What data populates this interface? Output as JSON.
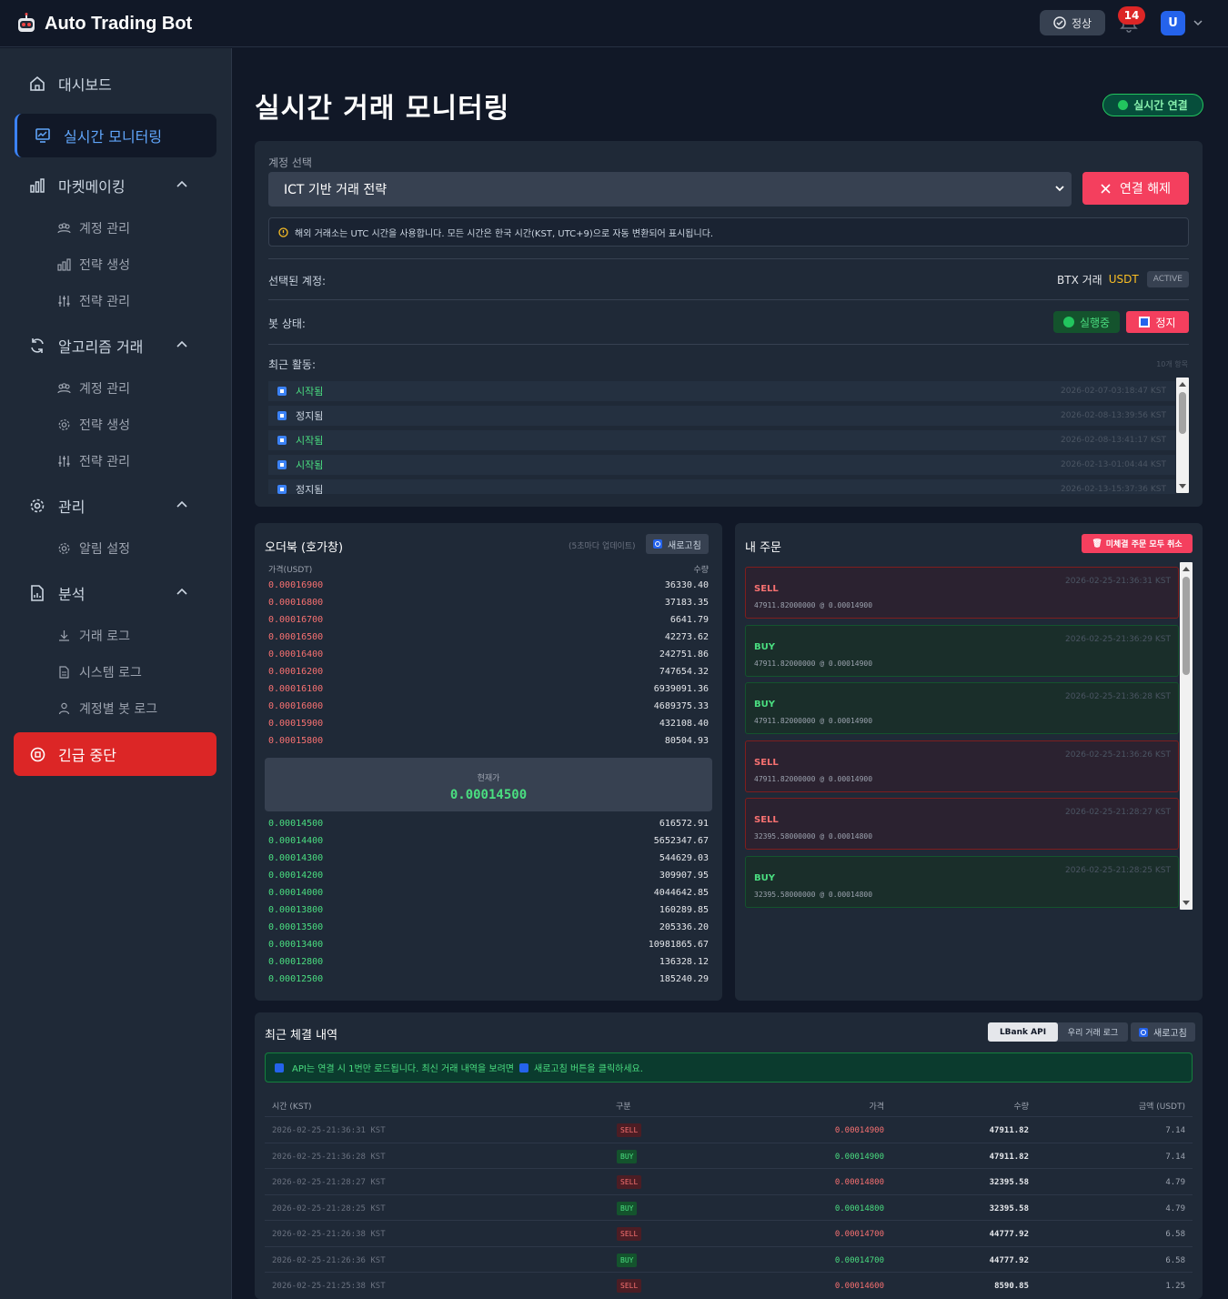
{
  "app": {
    "title": "Auto Trading Bot",
    "status_label": "정상",
    "notification_count": "14",
    "avatar_initial": "U"
  },
  "sidebar": {
    "dashboard": "대시보드",
    "live_monitoring": "실시간 모니터링",
    "market_making": {
      "label": "마켓메이킹",
      "items": [
        "계정 관리",
        "전략 생성",
        "전략 관리"
      ]
    },
    "algo_trading": {
      "label": "알고리즘 거래",
      "items": [
        "계정 관리",
        "전략 생성",
        "전략 관리"
      ]
    },
    "management": {
      "label": "관리",
      "items": [
        "알림 설정"
      ]
    },
    "analysis": {
      "label": "분석",
      "items": [
        "거래 로그",
        "시스템 로그",
        "계정별 봇 로그"
      ]
    },
    "emergency_stop": "긴급 중단"
  },
  "main": {
    "title": "실시간 거래 모니터링",
    "live_badge": "실시간 연결"
  },
  "account": {
    "select_label": "계정 선택",
    "selected_value": "ICT 기반 거래 전략",
    "disconnect_label": "연결 해제",
    "tz_notice": "해외 거래소는 UTC 시간을 사용합니다. 모든 시간은 한국 시간(KST, UTC+9)으로 자동 변환되어 표시됩니다.",
    "selected_account_label": "선택된 계정:",
    "selected_account_name": "BTX 거래",
    "selected_account_currency": "USDT",
    "selected_account_status": "ACTIVE",
    "bot_status_label": "봇 상태:",
    "running_label": "실행중",
    "stop_label": "정지",
    "recent_activity_label": "최근 활동:",
    "activity_count": "10개 항목",
    "activities": [
      {
        "label": "시작됨",
        "time": "2026-02-07-03:18:47 KST",
        "kind": "start"
      },
      {
        "label": "정지됨",
        "time": "2026-02-08-13:39:56 KST",
        "kind": "stop"
      },
      {
        "label": "시작됨",
        "time": "2026-02-08-13:41:17 KST",
        "kind": "start"
      },
      {
        "label": "시작됨",
        "time": "2026-02-13-01:04:44 KST",
        "kind": "start"
      },
      {
        "label": "정지됨",
        "time": "2026-02-13-15:37:36 KST",
        "kind": "stop"
      }
    ]
  },
  "orderbook": {
    "title": "오더북 (호가창)",
    "update_note": "(5초마다 업데이트)",
    "refresh_label": "새로고침",
    "price_header": "가격(USDT)",
    "qty_header": "수량",
    "asks": [
      {
        "price": "0.00016900",
        "qty": "36330.40"
      },
      {
        "price": "0.00016800",
        "qty": "37183.35"
      },
      {
        "price": "0.00016700",
        "qty": "6641.79"
      },
      {
        "price": "0.00016500",
        "qty": "42273.62"
      },
      {
        "price": "0.00016400",
        "qty": "242751.86"
      },
      {
        "price": "0.00016200",
        "qty": "747654.32"
      },
      {
        "price": "0.00016100",
        "qty": "6939091.36"
      },
      {
        "price": "0.00016000",
        "qty": "4689375.33"
      },
      {
        "price": "0.00015900",
        "qty": "432108.40"
      },
      {
        "price": "0.00015800",
        "qty": "80504.93"
      }
    ],
    "current_label": "현재가",
    "current_price": "0.00014500",
    "bids": [
      {
        "price": "0.00014500",
        "qty": "616572.91"
      },
      {
        "price": "0.00014400",
        "qty": "5652347.67"
      },
      {
        "price": "0.00014300",
        "qty": "544629.03"
      },
      {
        "price": "0.00014200",
        "qty": "309907.95"
      },
      {
        "price": "0.00014000",
        "qty": "4044642.85"
      },
      {
        "price": "0.00013800",
        "qty": "160289.85"
      },
      {
        "price": "0.00013500",
        "qty": "205336.20"
      },
      {
        "price": "0.00013400",
        "qty": "10981865.67"
      },
      {
        "price": "0.00012800",
        "qty": "136328.12"
      },
      {
        "price": "0.00012500",
        "qty": "185240.29"
      }
    ]
  },
  "my_orders": {
    "title": "내 주문",
    "cancel_all_label": "미체결 주문 모두 취소",
    "orders": [
      {
        "side": "SELL",
        "time": "2026-02-25-21:36:31 KST",
        "detail": "47911.82000000 @ 0.00014900"
      },
      {
        "side": "BUY",
        "time": "2026-02-25-21:36:29 KST",
        "detail": "47911.82000000 @ 0.00014900"
      },
      {
        "side": "BUY",
        "time": "2026-02-25-21:36:28 KST",
        "detail": "47911.82000000 @ 0.00014900"
      },
      {
        "side": "SELL",
        "time": "2026-02-25-21:36:26 KST",
        "detail": "47911.82000000 @ 0.00014900"
      },
      {
        "side": "SELL",
        "time": "2026-02-25-21:28:27 KST",
        "detail": "32395.58000000 @ 0.00014800"
      },
      {
        "side": "BUY",
        "time": "2026-02-25-21:28:25 KST",
        "detail": "32395.58000000 @ 0.00014800"
      }
    ]
  },
  "trades": {
    "title": "최근 체결 내역",
    "tabs": [
      "LBank API",
      "우리 거래 로그"
    ],
    "refresh_label": "새로고침",
    "info_text_1": "API는 연결 시 1번만 로드됩니다. 최신 거래 내역을 보려면",
    "info_text_2": "새로고침 버튼을 클릭하세요.",
    "headers": {
      "time": "시간 (KST)",
      "side": "구분",
      "price": "가격",
      "qty": "수량",
      "amount": "금액 (USDT)"
    },
    "rows": [
      {
        "time": "2026-02-25-21:36:31 KST",
        "side": "SELL",
        "price": "0.00014900",
        "qty": "47911.82",
        "amount": "7.14"
      },
      {
        "time": "2026-02-25-21:36:28 KST",
        "side": "BUY",
        "price": "0.00014900",
        "qty": "47911.82",
        "amount": "7.14"
      },
      {
        "time": "2026-02-25-21:28:27 KST",
        "side": "SELL",
        "price": "0.00014800",
        "qty": "32395.58",
        "amount": "4.79"
      },
      {
        "time": "2026-02-25-21:28:25 KST",
        "side": "BUY",
        "price": "0.00014800",
        "qty": "32395.58",
        "amount": "4.79"
      },
      {
        "time": "2026-02-25-21:26:38 KST",
        "side": "SELL",
        "price": "0.00014700",
        "qty": "44777.92",
        "amount": "6.58"
      },
      {
        "time": "2026-02-25-21:26:36 KST",
        "side": "BUY",
        "price": "0.00014700",
        "qty": "44777.92",
        "amount": "6.58"
      },
      {
        "time": "2026-02-25-21:25:38 KST",
        "side": "SELL",
        "price": "0.00014600",
        "qty": "8590.85",
        "amount": "1.25"
      }
    ]
  }
}
